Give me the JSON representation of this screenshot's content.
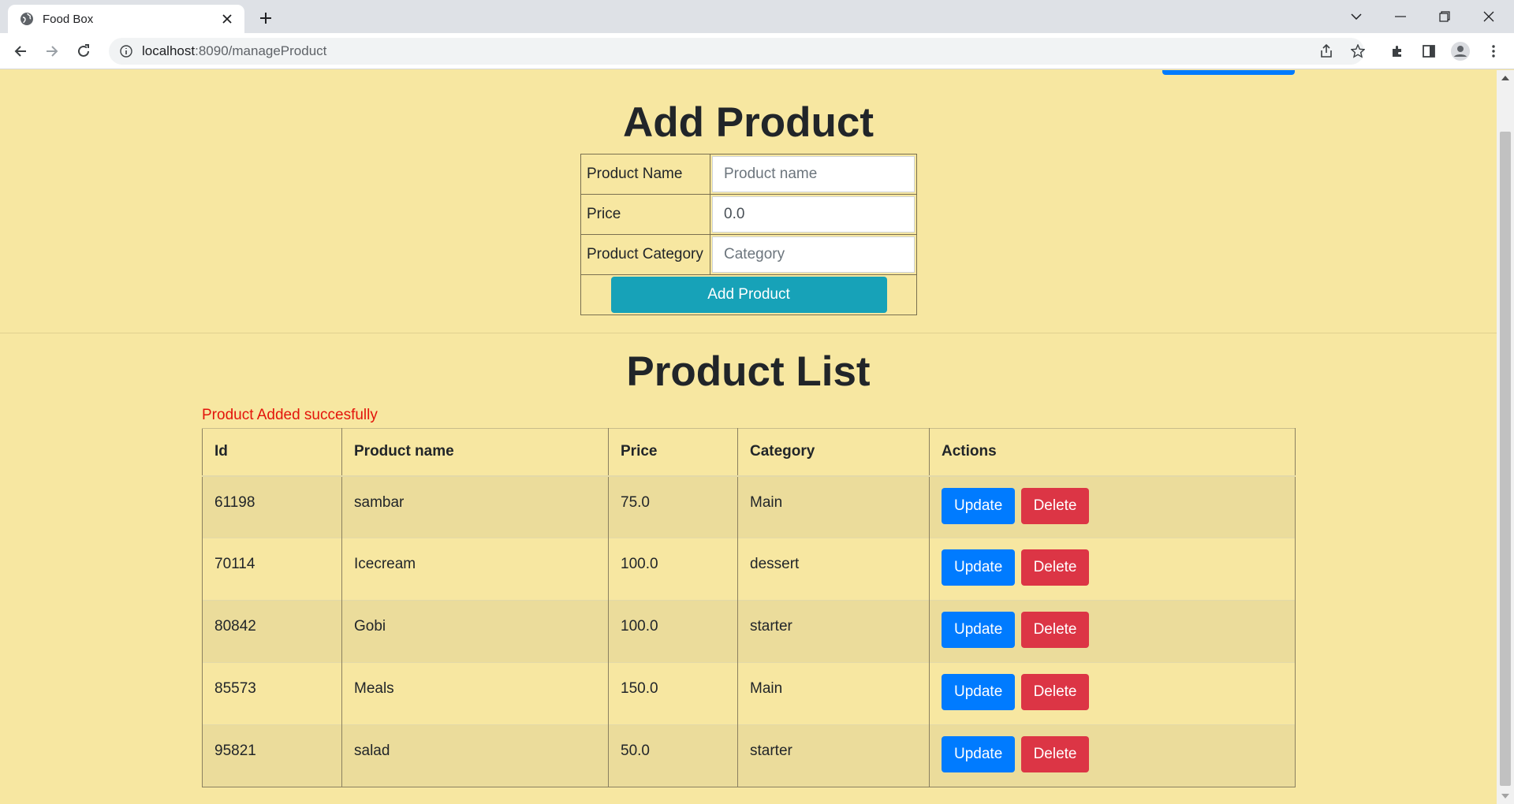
{
  "browser": {
    "tab_title": "Food Box",
    "url_host": "localhost",
    "url_rest": ":8090/manageProduct"
  },
  "add_form": {
    "heading": "Add Product",
    "name_label": "Product Name",
    "name_placeholder": "Product name",
    "price_label": "Price",
    "price_value": "0.0",
    "category_label": "Product Category",
    "category_placeholder": "Category",
    "submit_label": "Add Product"
  },
  "list": {
    "heading": "Product List",
    "message": "Product Added succesfully",
    "columns": [
      "Id",
      "Product name",
      "Price",
      "Category",
      "Actions"
    ],
    "update_label": "Update",
    "delete_label": "Delete",
    "rows": [
      {
        "id": "61198",
        "name": "sambar",
        "price": "75.0",
        "category": "Main"
      },
      {
        "id": "70114",
        "name": "Icecream",
        "price": "100.0",
        "category": "dessert"
      },
      {
        "id": "80842",
        "name": "Gobi",
        "price": "100.0",
        "category": "starter"
      },
      {
        "id": "85573",
        "name": "Meals",
        "price": "150.0",
        "category": "Main"
      },
      {
        "id": "95821",
        "name": "salad",
        "price": "50.0",
        "category": "starter"
      }
    ]
  },
  "colors": {
    "page_bg": "#f7e7a1",
    "primary": "#007bff",
    "danger": "#dc3545",
    "info": "#17a2b8",
    "message": "#e3140b"
  }
}
